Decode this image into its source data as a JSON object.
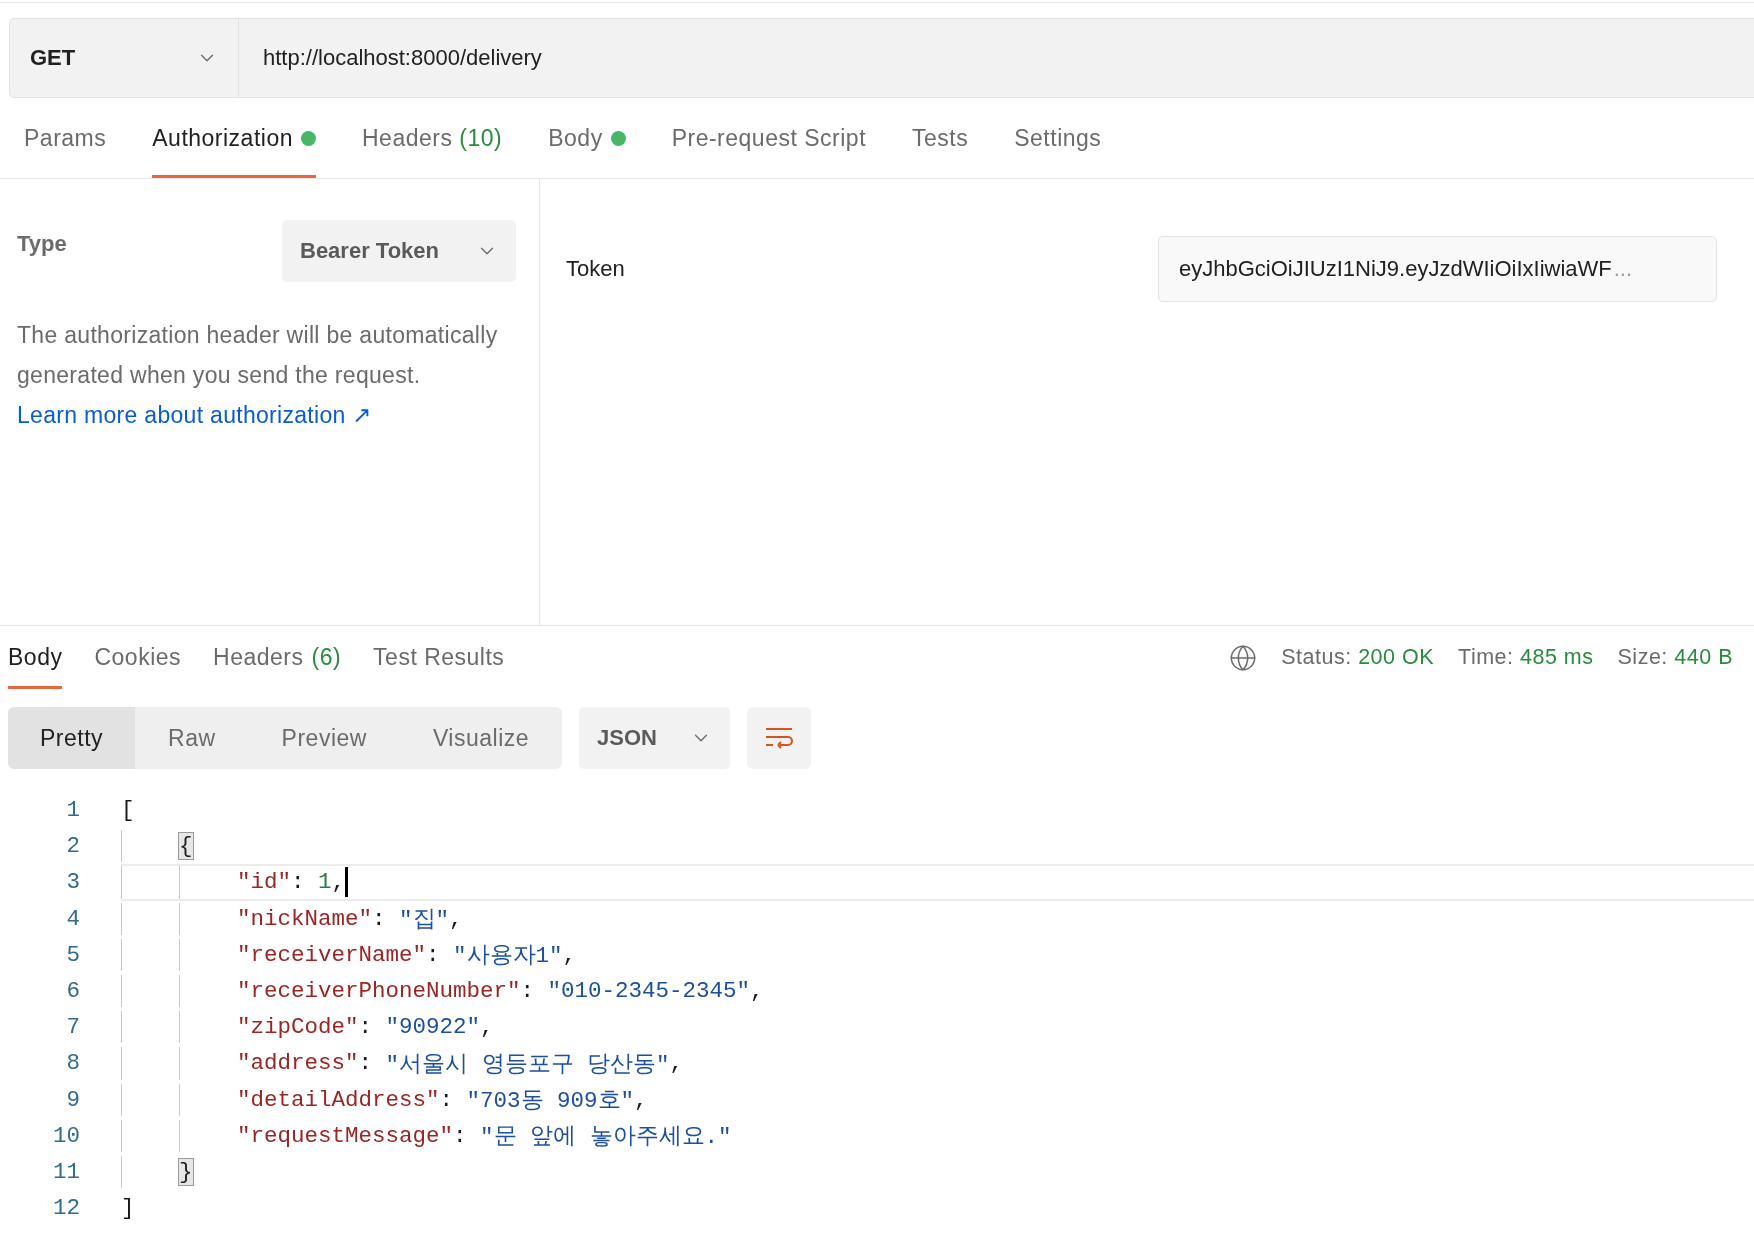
{
  "request": {
    "method": "GET",
    "url": "http://localhost:8000/delivery"
  },
  "request_tabs": [
    {
      "label": "Params",
      "selected": false,
      "dot": false
    },
    {
      "label": "Authorization",
      "selected": true,
      "dot": true
    },
    {
      "label": "Headers",
      "count": "(10)",
      "selected": false,
      "dot": false
    },
    {
      "label": "Body",
      "selected": false,
      "dot": true
    },
    {
      "label": "Pre-request Script",
      "selected": false,
      "dot": false
    },
    {
      "label": "Tests",
      "selected": false,
      "dot": false
    },
    {
      "label": "Settings",
      "selected": false,
      "dot": false
    }
  ],
  "auth": {
    "type_label": "Type",
    "type_value": "Bearer Token",
    "description": "The authorization header will be automatically generated when you send the request.",
    "link": "Learn more about authorization ↗",
    "token_label": "Token",
    "token_value": "eyJhbGciOiJIUzI1NiJ9.eyJzdWIiOiIxIiwiaWF",
    "token_overflow": "..."
  },
  "response_tabs": [
    {
      "label": "Body",
      "selected": true
    },
    {
      "label": "Cookies",
      "selected": false
    },
    {
      "label": "Headers",
      "count": "(6)",
      "selected": false
    },
    {
      "label": "Test Results",
      "selected": false
    }
  ],
  "status": {
    "status_label": "Status:",
    "status_value": "200 OK",
    "time_label": "Time:",
    "time_value": "485 ms",
    "size_label": "Size:",
    "size_value": "440 B"
  },
  "view_modes": [
    {
      "label": "Pretty",
      "selected": true
    },
    {
      "label": "Raw",
      "selected": false
    },
    {
      "label": "Preview",
      "selected": false
    },
    {
      "label": "Visualize",
      "selected": false
    }
  ],
  "format": "JSON",
  "code_lines": [
    {
      "number": "1",
      "cursor": false,
      "tokens": [
        {
          "kind": "punct",
          "text": "["
        }
      ],
      "children": [
        {
          "number": "2",
          "cursor": false,
          "tokens": [
            {
              "kind": "match",
              "text": "{"
            }
          ],
          "children": [
            {
              "number": "3",
              "cursor": true,
              "tokens": [
                {
                  "kind": "key",
                  "text": "\"id\""
                },
                {
                  "kind": "punct",
                  "text": ": "
                },
                {
                  "kind": "number",
                  "text": "1"
                },
                {
                  "kind": "punct",
                  "text": ","
                }
              ]
            },
            {
              "number": "4",
              "cursor": false,
              "tokens": [
                {
                  "kind": "key",
                  "text": "\"nickName\""
                },
                {
                  "kind": "punct",
                  "text": ": "
                },
                {
                  "kind": "string",
                  "text": "\"집\""
                },
                {
                  "kind": "punct",
                  "text": ","
                }
              ]
            },
            {
              "number": "5",
              "cursor": false,
              "tokens": [
                {
                  "kind": "key",
                  "text": "\"receiverName\""
                },
                {
                  "kind": "punct",
                  "text": ": "
                },
                {
                  "kind": "string",
                  "text": "\"사용자1\""
                },
                {
                  "kind": "punct",
                  "text": ","
                }
              ]
            },
            {
              "number": "6",
              "cursor": false,
              "tokens": [
                {
                  "kind": "key",
                  "text": "\"receiverPhoneNumber\""
                },
                {
                  "kind": "punct",
                  "text": ": "
                },
                {
                  "kind": "string",
                  "text": "\"010-2345-2345\""
                },
                {
                  "kind": "punct",
                  "text": ","
                }
              ]
            },
            {
              "number": "7",
              "cursor": false,
              "tokens": [
                {
                  "kind": "key",
                  "text": "\"zipCode\""
                },
                {
                  "kind": "punct",
                  "text": ": "
                },
                {
                  "kind": "string",
                  "text": "\"90922\""
                },
                {
                  "kind": "punct",
                  "text": ","
                }
              ]
            },
            {
              "number": "8",
              "cursor": false,
              "tokens": [
                {
                  "kind": "key",
                  "text": "\"address\""
                },
                {
                  "kind": "punct",
                  "text": ": "
                },
                {
                  "kind": "string",
                  "text": "\"서울시 영등포구 당산동\""
                },
                {
                  "kind": "punct",
                  "text": ","
                }
              ]
            },
            {
              "number": "9",
              "cursor": false,
              "tokens": [
                {
                  "kind": "key",
                  "text": "\"detailAddress\""
                },
                {
                  "kind": "punct",
                  "text": ": "
                },
                {
                  "kind": "string",
                  "text": "\"703동 909호\""
                },
                {
                  "kind": "punct",
                  "text": ","
                }
              ]
            },
            {
              "number": "10",
              "cursor": false,
              "tokens": [
                {
                  "kind": "key",
                  "text": "\"requestMessage\""
                },
                {
                  "kind": "punct",
                  "text": ": "
                },
                {
                  "kind": "string",
                  "text": "\"문 앞에 놓아주세요.\""
                }
              ]
            }
          ]
        },
        {
          "number": "11",
          "cursor": false,
          "tokens": [
            {
              "kind": "match",
              "text": "}"
            }
          ]
        }
      ]
    },
    {
      "number": "12",
      "cursor": false,
      "tokens": [
        {
          "kind": "punct",
          "text": "]"
        }
      ]
    }
  ]
}
